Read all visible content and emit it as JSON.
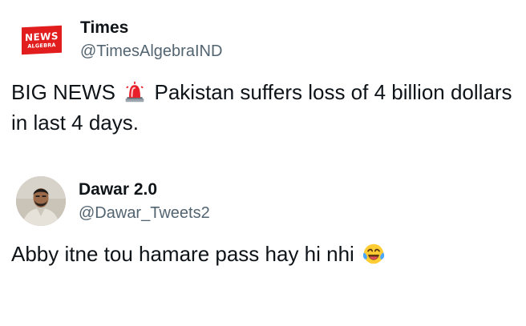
{
  "tweets": [
    {
      "display_name": "Times",
      "handle": "@TimesAlgebraIND",
      "avatar": {
        "logo_text_top": "NEWS",
        "logo_text_bottom": "ALGEBRA",
        "logo_color": "#e11d1d"
      },
      "text_before_emoji": "BIG NEWS",
      "emoji": "police-siren-emoji",
      "text_after_emoji": "Pakistan suffers loss of 4 billion dollars in last 4 days."
    },
    {
      "display_name": "Dawar 2.0",
      "handle": "@Dawar_Tweets2",
      "avatar": {
        "type": "photo"
      },
      "text_before_emoji": "Abby itne tou hamare pass hay hi nhi",
      "emoji": "face-with-tears-of-joy-emoji"
    }
  ],
  "colors": {
    "text_primary": "#0f1419",
    "text_secondary": "#536471",
    "background": "#ffffff"
  }
}
